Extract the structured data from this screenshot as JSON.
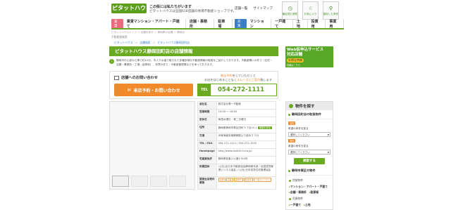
{
  "header": {
    "logo": "ピタットハウス",
    "tagline": "この街には私たちがいます",
    "tagline_sub": "ピタットハウスは全国618店舗の地場不動産ショップです。",
    "links": [
      "店舗一覧",
      "サイトマップ"
    ],
    "icons": [
      {
        "icon": "clock-icon",
        "label": "最近見た物件"
      },
      {
        "icon": "star-icon",
        "label": "お気に入り"
      },
      {
        "icon": "search-icon",
        "label": "保存した条件"
      }
    ]
  },
  "nav": {
    "badge_rent": "賃貸",
    "items_rent": [
      "賃貸マンション・アパート・戸建て",
      "店舗・事務所",
      "駐車場"
    ],
    "badge_sale": "売買",
    "items_sale": [
      "マンション",
      "一戸建て",
      "土地",
      "投資用",
      "事業用"
    ]
  },
  "breadcrumb": "ピタットハウストップ ＞ 店舗を探す ＞ 静岡県の店舗 ＞ 静岡店",
  "store_small_title": "不動産屋検索",
  "crumb2": [
    "ピタットハウス",
    "店舗検索",
    "ピタットハウス静岡田町店"
  ],
  "title": {
    "main": "ピタットハウス静岡田町店の店舗情報",
    "marker": "▷"
  },
  "intro": "静岡市中心部から車で約10分。市人下水道で取られた多種多様な不動産情報の取扱をご紹介しております。不動産購入の件で（住宅・店舗・事務所・工場・倉庫他）、売買の件で・不動産管理業などを承っております。",
  "contact": {
    "heading": "店舗へのお問い合わせ",
    "button": "来店予約・お問い合わせ",
    "yoyaku_line1_prefix": "来店予約",
    "yoyaku_line1_suffix": "をしていただくと",
    "yoyaku_line2_prefix": "お店をはじめることなく",
    "yoyaku_line2_hl": "スムーズにご案内",
    "yoyaku_line2_suffix": "致します",
    "tel_label": "TEL",
    "tel": "054-272-1111"
  },
  "info": [
    {
      "k": "会社名",
      "v": "株式会社第一不動産"
    },
    {
      "k": "営業時間",
      "v": "10:00 〜 18:00"
    },
    {
      "k": "定休日",
      "v": "毎週水曜日・第二日曜日"
    },
    {
      "k": "住所",
      "v": "静岡県静岡市葵区田町５丁目10-1",
      "mini": "地図を見る"
    },
    {
      "k": "交通",
      "v": "JR東海道本線静岡駅より徒歩２３分"
    },
    {
      "k": "TEL / FAX",
      "v": "054-272-1111 / 054-272-1555"
    },
    {
      "k": "Homepage",
      "v": "http://www.daiichi-fu.co.jp/"
    },
    {
      "k": "宅建業免許",
      "v": "静岡県知事(11)第1704号"
    },
    {
      "k": "所属団体",
      "v": "(公社)全日本不動産協会静岡県本部 / 全国賃貸管理ビジネス協会 / (公社)日本賃貸住宅管理協会"
    },
    {
      "k": "賃貸全店物件募集",
      "tags": [
        "住居",
        "店舗",
        "事務所",
        "駐車場",
        "一括キャンセル"
      ]
    }
  ],
  "side": {
    "banner_title1": "Web仮申込サービス",
    "banner_title2": "対応店舗",
    "banner_pill": "お得な特典",
    "banner_small": "詳細はこちら",
    "search_title": "物件を探す",
    "local_title": "静岡田町店の取扱物件",
    "label_rent": "賃貸",
    "sel1_label": "希望の条件を見る",
    "sel1_value": "選択してください",
    "label_buy": "売買",
    "sel2_label": "希望の条件を見る",
    "sel2_value": "選択してください",
    "btn": "検索する",
    "area_title": "静岡市葵区の物件",
    "rent_head": "賃貸物件",
    "rent1": "マンション・アパート・戸建て",
    "rent2a": "店舗・事務所",
    "rent2b": "駐車場",
    "sale_head": "売買物件",
    "sale1": "一戸建て",
    "sale2": "土地"
  },
  "colors": {
    "green": "#6aaa21",
    "orange": "#f08a2a",
    "pink": "#e96a7c",
    "blue": "#3b7ec6"
  }
}
